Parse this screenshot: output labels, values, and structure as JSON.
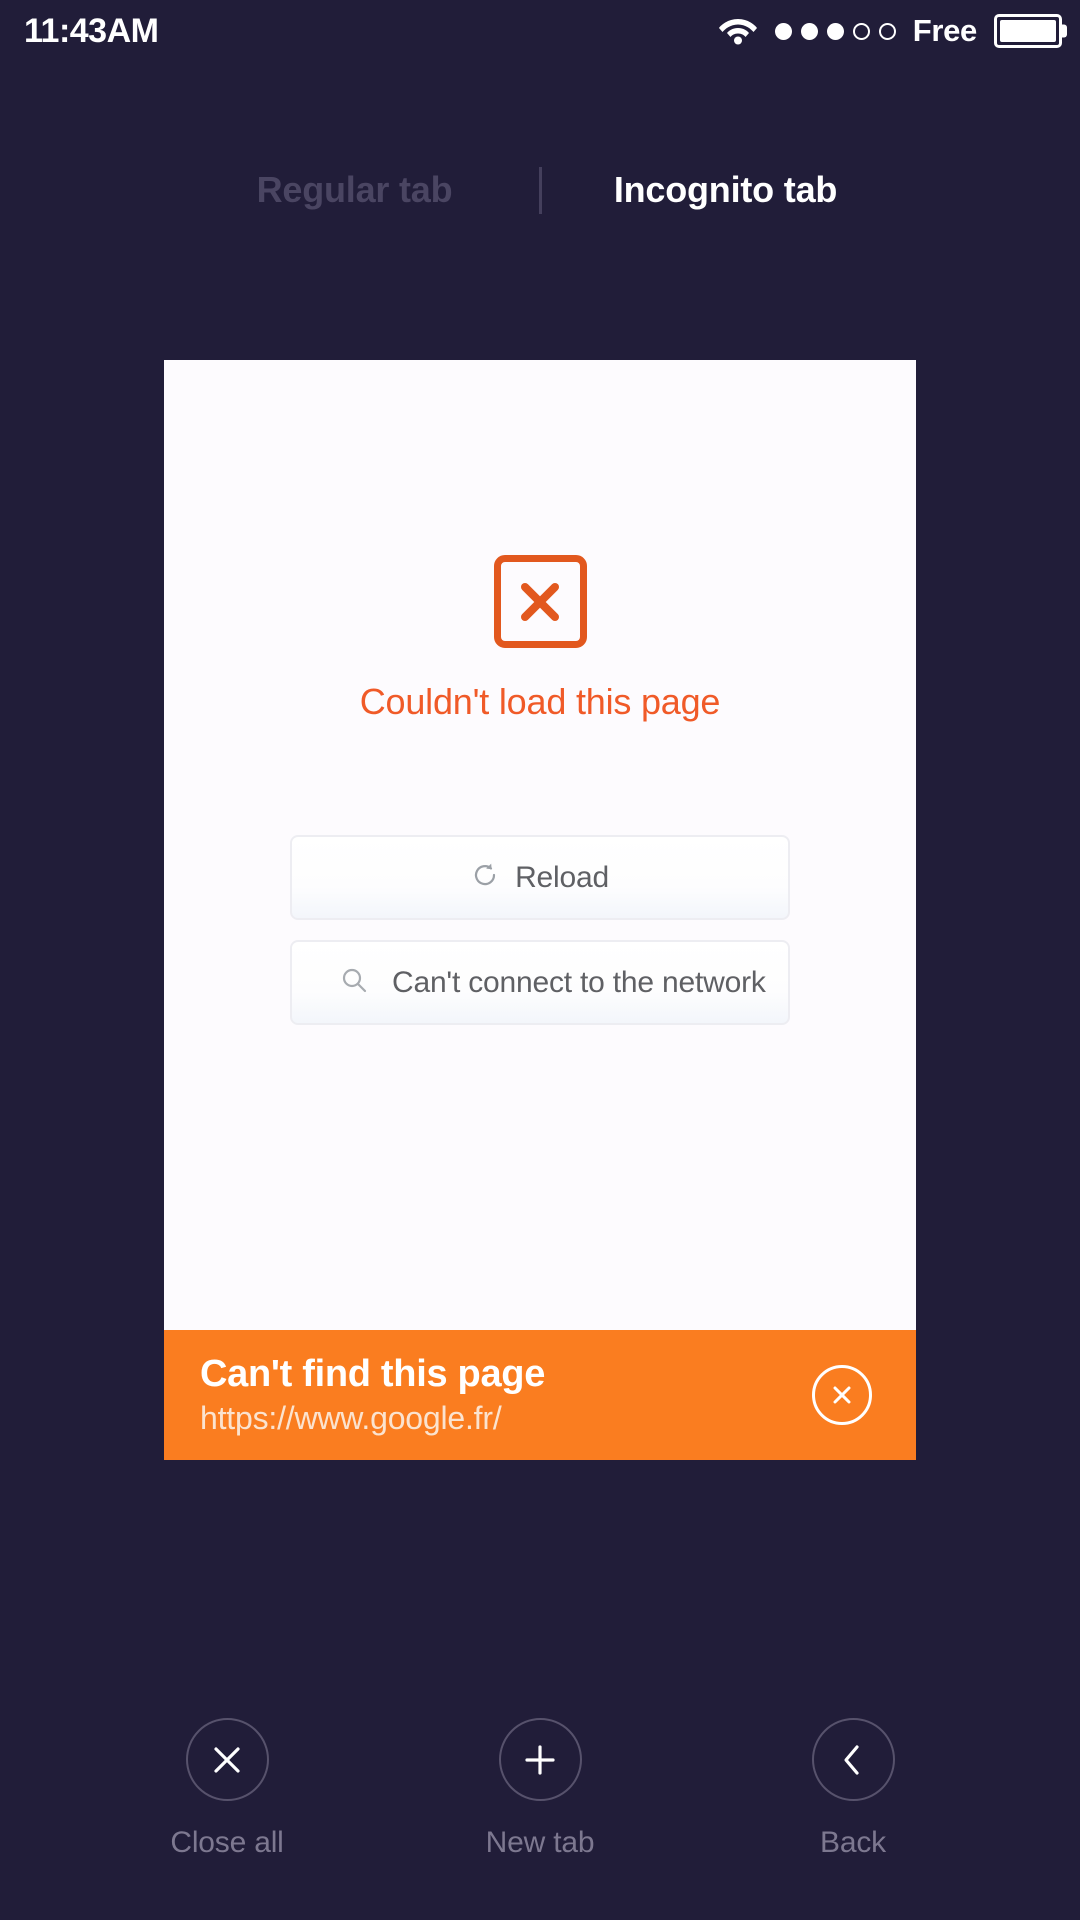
{
  "statusbar": {
    "time": "11:43AM",
    "carrier": "Free",
    "wifi_icon": "wifi-icon",
    "battery_icon": "battery-full-icon",
    "signal_dots": {
      "total": 5,
      "filled": 3
    }
  },
  "tabs": {
    "regular": {
      "label": "Regular tab",
      "active": false
    },
    "incognito": {
      "label": "Incognito tab",
      "active": true
    }
  },
  "page_card": {
    "error": {
      "icon": "error-x-box-icon",
      "message": "Couldn't load this page",
      "color": "#F05A28"
    },
    "actions": [
      {
        "icon": "reload-icon",
        "label": "Reload"
      },
      {
        "icon": "search-icon",
        "label": "Can't connect to the network"
      }
    ],
    "banner": {
      "title": "Can't find this page",
      "url": "https://www.google.fr/",
      "close_icon": "close-circle-icon",
      "background": "#FA7D20"
    }
  },
  "bottom_nav": [
    {
      "icon": "close-icon",
      "label": "Close all"
    },
    {
      "icon": "plus-icon",
      "label": "New tab"
    },
    {
      "icon": "chevron-left-icon",
      "label": "Back"
    }
  ]
}
